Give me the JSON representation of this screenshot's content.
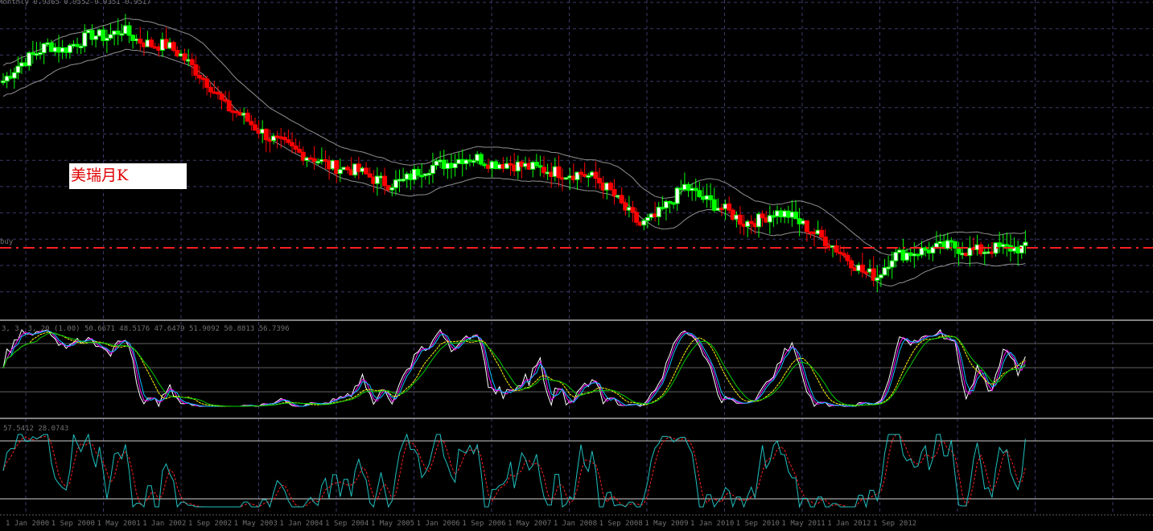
{
  "header": {
    "symbol_period": "Monthly",
    "ohlc": "0.9365 0.9552 0.9351 0.9517"
  },
  "annotation": "美瑞月K",
  "price_line_label": "buy",
  "indicator1_label": "3, 3, 3, 20 (1.00) 50.6671 48.5176 47.6479 51.9092 50.8813 56.7396",
  "indicator2_label": "57.5412 28.0743",
  "colors": {
    "background": "#000000",
    "grid": "#3a3a6a",
    "bull": "#00ff00",
    "bear_trend": "#ff0000",
    "price_line": "#ff2020"
  },
  "chart_data": {
    "type": "candlestick",
    "title": "USDCHF Monthly",
    "current_price": 0.9517,
    "x_tick_labels": [
      "1 Jan 2000",
      "1 Sep 2000",
      "1 May 2001",
      "1 Jan 2002",
      "1 Sep 2002",
      "1 May 2003",
      "1 Jan 2004",
      "1 Sep 2004",
      "1 May 2005",
      "1 Jan 2006",
      "1 Sep 2006",
      "1 May 2007",
      "1 Jan 2008",
      "1 Sep 2008",
      "1 May 2009",
      "1 Jan 2010",
      "1 Sep 2010",
      "1 May 2011",
      "1 Jan 2012",
      "1 Sep 2012"
    ],
    "close_every_4_bars": [
      1.6,
      1.66,
      1.7,
      1.74,
      1.72,
      1.75,
      1.78,
      1.77,
      1.8,
      1.76,
      1.74,
      1.74,
      1.7,
      1.64,
      1.58,
      1.5,
      1.47,
      1.42,
      1.38,
      1.35,
      1.32,
      1.3,
      1.27,
      1.26,
      1.25,
      1.22,
      1.2,
      1.21,
      1.25,
      1.27,
      1.28,
      1.3,
      1.3,
      1.28,
      1.28,
      1.27,
      1.26,
      1.25,
      1.24,
      1.24,
      1.22,
      1.17,
      1.1,
      1.04,
      1.07,
      1.13,
      1.19,
      1.15,
      1.12,
      1.09,
      1.05,
      1.06,
      1.09,
      1.08,
      1.04,
      1.0,
      0.96,
      0.91,
      0.86,
      0.84,
      0.92,
      0.93,
      0.94,
      0.95,
      0.96,
      0.94,
      0.94,
      0.95,
      0.95,
      0.95
    ],
    "y_range": [
      0.72,
      1.82
    ]
  }
}
